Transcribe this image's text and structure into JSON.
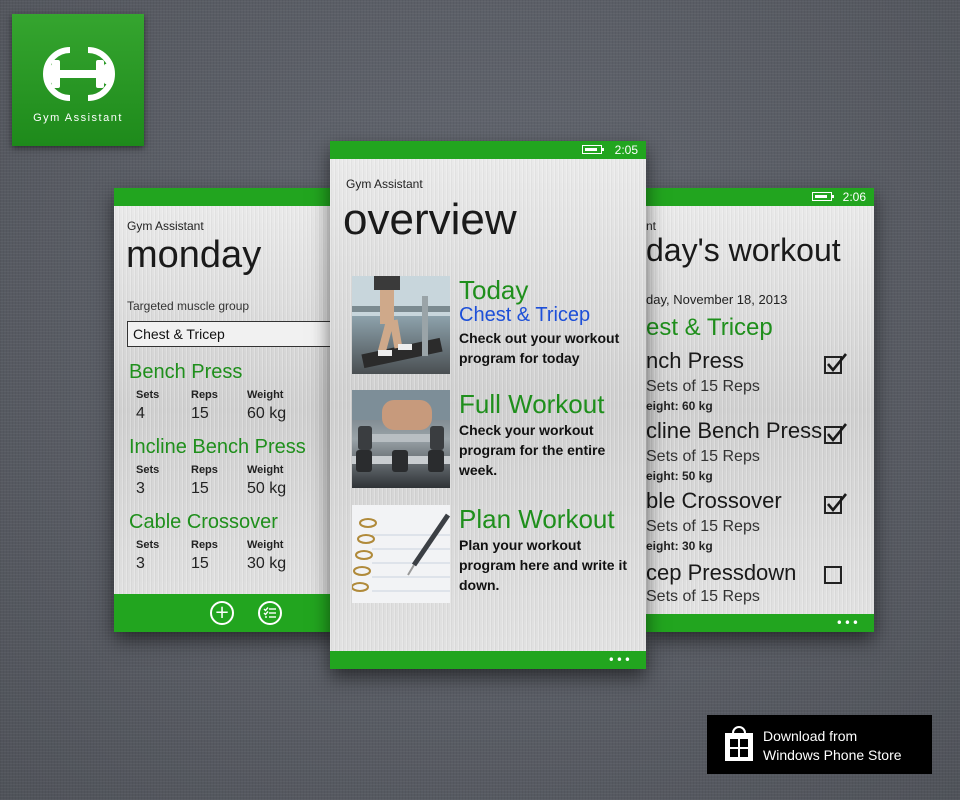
{
  "logo": {
    "text": "Gym Assistant"
  },
  "colors": {
    "accent": "#22a51f",
    "title_green": "#1f8f1c",
    "subtitle_blue": "#1d4fd8"
  },
  "left_phone": {
    "app_title": "Gym Assistant",
    "page_title": "monday",
    "muscle_label": "Targeted muscle group",
    "muscle_value": "Chest & Tricep",
    "exercises": [
      {
        "name": "Bench Press",
        "sets_label": "Sets",
        "reps_label": "Reps",
        "weight_label": "Weight",
        "sets": "4",
        "reps": "15",
        "weight": "60 kg"
      },
      {
        "name": "Incline Bench Press",
        "sets_label": "Sets",
        "reps_label": "Reps",
        "weight_label": "Weight",
        "sets": "3",
        "reps": "15",
        "weight": "50 kg"
      },
      {
        "name": "Cable Crossover",
        "sets_label": "Sets",
        "reps_label": "Reps",
        "weight_label": "Weight",
        "sets": "3",
        "reps": "15",
        "weight": "30 kg"
      }
    ],
    "appbar_icons": [
      "add-icon",
      "list-icon"
    ]
  },
  "center_phone": {
    "time": "2:05",
    "app_title": "Gym Assistant",
    "page_title": "overview",
    "tiles": [
      {
        "title": "Today",
        "subtitle": "Chest & Tricep",
        "desc": "Check out your workout program for today"
      },
      {
        "title": "Full Workout",
        "desc": "Check your workout program for the entire week."
      },
      {
        "title": "Plan Workout",
        "desc": "Plan your workout program here and write it down."
      }
    ],
    "more": "•••"
  },
  "right_phone": {
    "time": "2:06",
    "app_title": "nt",
    "page_title": "day's workout",
    "date": "day, November 18, 2013",
    "group": "est & Tricep",
    "items": [
      {
        "name": "nch Press",
        "sets": "Sets of 15 Reps",
        "weight_label": "eight: 60 kg",
        "checked": true
      },
      {
        "name": "cline Bench Press",
        "sets": "Sets of 15 Reps",
        "weight_label": "eight: 50 kg",
        "checked": true
      },
      {
        "name": "ble Crossover",
        "sets": "Sets of 15 Reps",
        "weight_label": "eight: 30 kg",
        "checked": true
      },
      {
        "name": "cep Pressdown",
        "sets": "Sets of 15 Reps",
        "checked": false
      }
    ],
    "more": "•••"
  },
  "store_badge": {
    "line1": "Download from",
    "line2": "Windows Phone Store"
  }
}
